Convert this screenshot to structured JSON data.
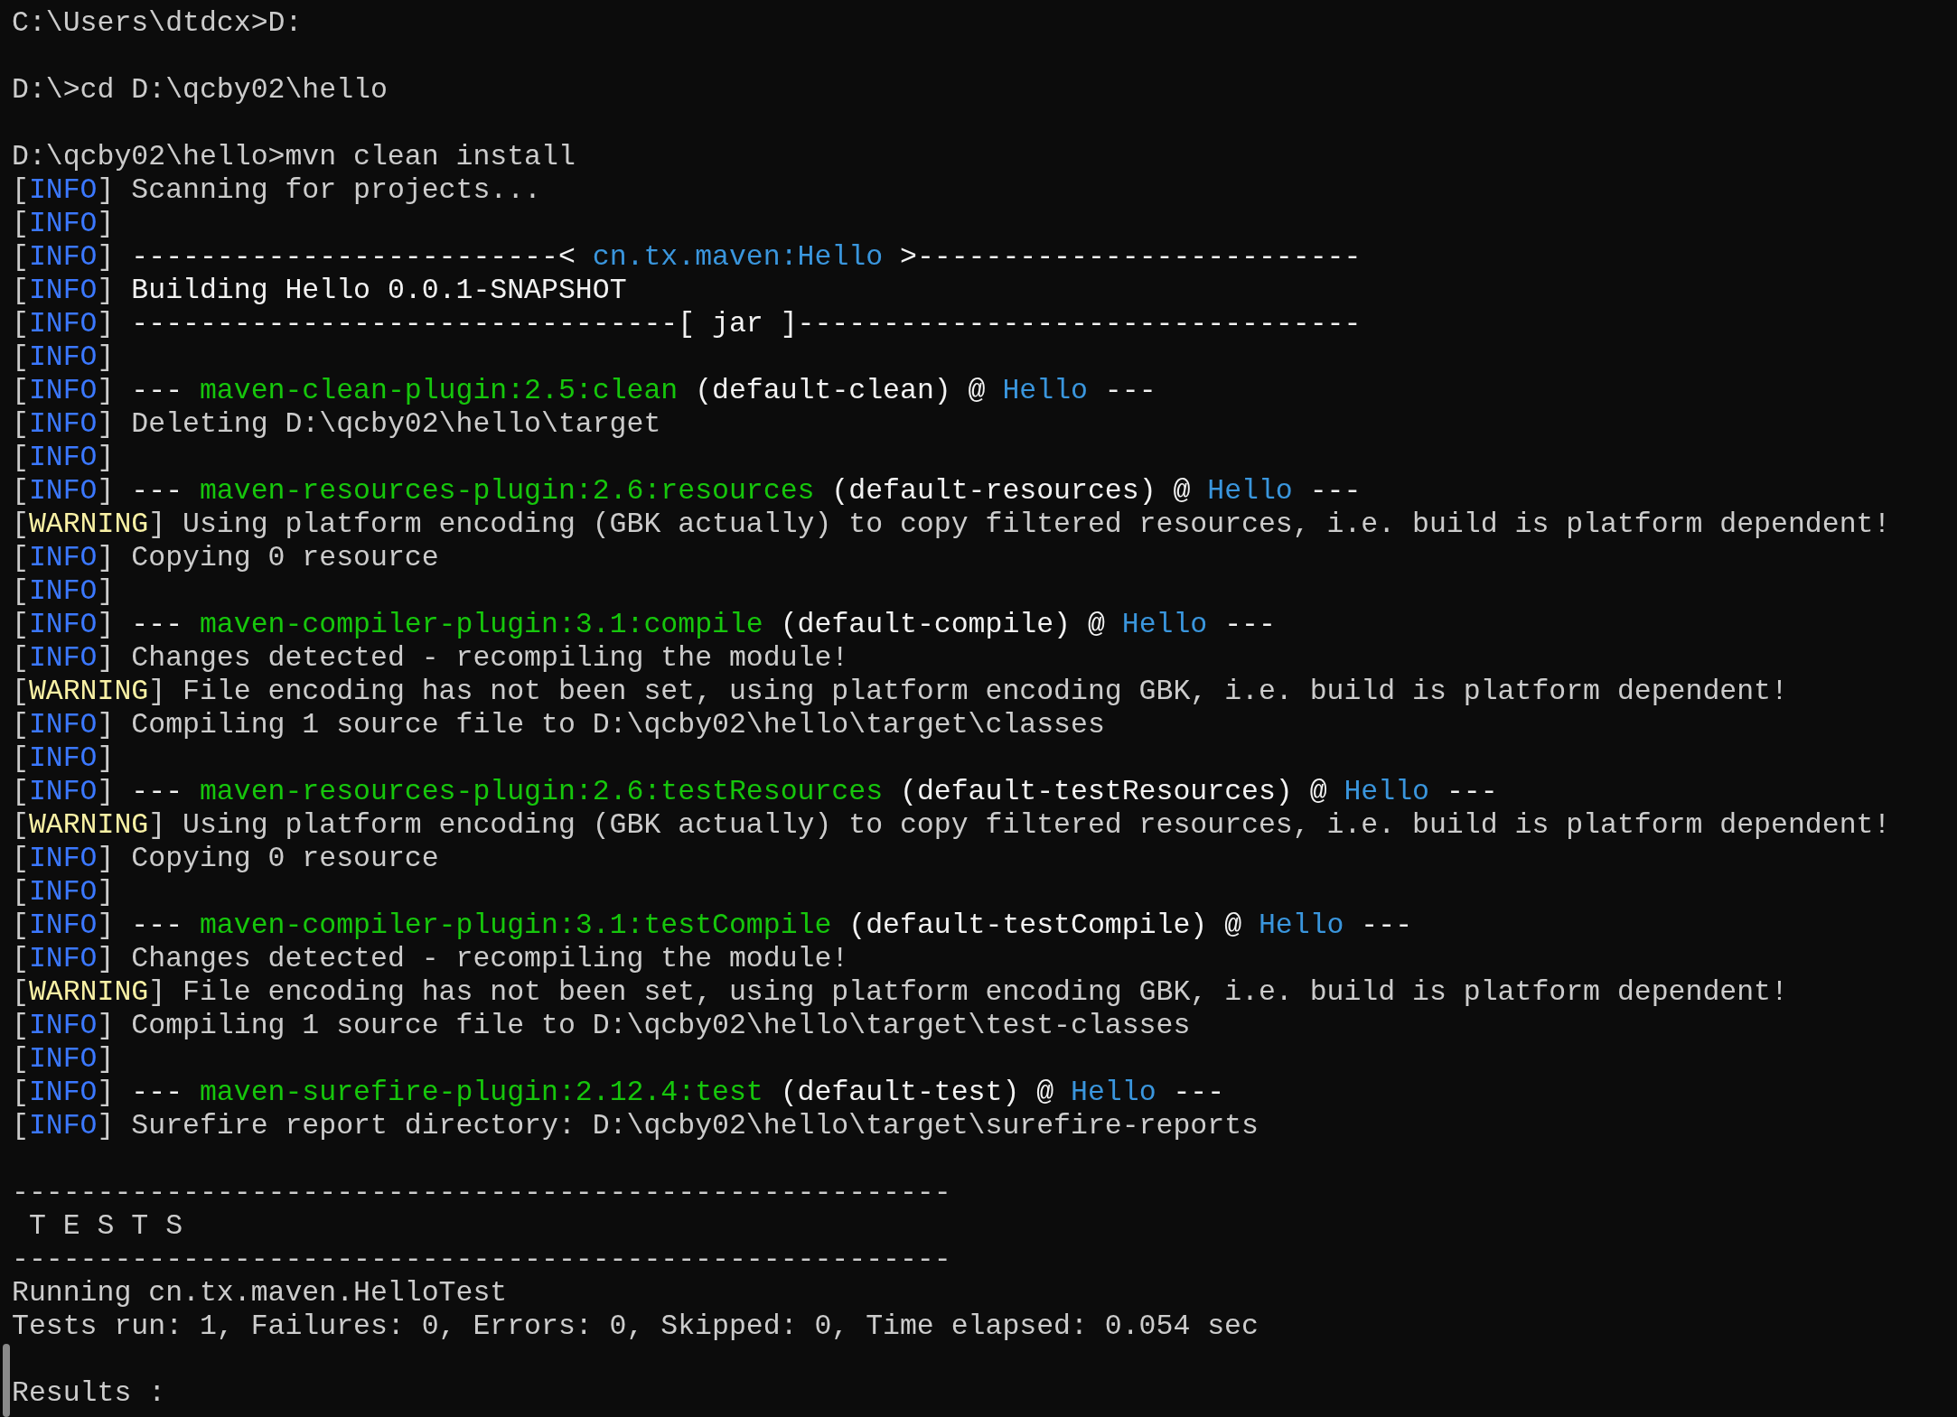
{
  "terminal": {
    "lines": [
      {
        "kind": "text",
        "segments": [
          {
            "kind": "plain",
            "text": "C:\\Users\\dtdcx>D:"
          }
        ]
      },
      {
        "kind": "blank"
      },
      {
        "kind": "text",
        "segments": [
          {
            "kind": "plain",
            "text": "D:\\>cd D:\\qcby02\\hello"
          }
        ]
      },
      {
        "kind": "blank"
      },
      {
        "kind": "text",
        "segments": [
          {
            "kind": "plain",
            "text": "D:\\qcby02\\hello>mvn clean install"
          }
        ]
      },
      {
        "kind": "text",
        "segments": [
          {
            "kind": "plain",
            "text": "["
          },
          {
            "kind": "info",
            "text": "INFO"
          },
          {
            "kind": "plain",
            "text": "] Scanning for projects..."
          }
        ]
      },
      {
        "kind": "text",
        "segments": [
          {
            "kind": "plain",
            "text": "["
          },
          {
            "kind": "info",
            "text": "INFO"
          },
          {
            "kind": "plain",
            "text": "]"
          }
        ]
      },
      {
        "kind": "text",
        "segments": [
          {
            "kind": "plain",
            "text": "["
          },
          {
            "kind": "info",
            "text": "INFO"
          },
          {
            "kind": "plain",
            "text": "]"
          },
          {
            "kind": "bright",
            "text": " -------------------------< "
          },
          {
            "kind": "artifact",
            "text": "cn.tx.maven:Hello"
          },
          {
            "kind": "bright",
            "text": " >--------------------------"
          }
        ]
      },
      {
        "kind": "text",
        "segments": [
          {
            "kind": "plain",
            "text": "["
          },
          {
            "kind": "info",
            "text": "INFO"
          },
          {
            "kind": "plain",
            "text": "]"
          },
          {
            "kind": "bright",
            "text": " Building Hello 0.0.1-SNAPSHOT"
          }
        ]
      },
      {
        "kind": "text",
        "segments": [
          {
            "kind": "plain",
            "text": "["
          },
          {
            "kind": "info",
            "text": "INFO"
          },
          {
            "kind": "plain",
            "text": "]"
          },
          {
            "kind": "bright",
            "text": " --------------------------------[ jar ]---------------------------------"
          }
        ]
      },
      {
        "kind": "text",
        "segments": [
          {
            "kind": "plain",
            "text": "["
          },
          {
            "kind": "info",
            "text": "INFO"
          },
          {
            "kind": "plain",
            "text": "]"
          }
        ]
      },
      {
        "kind": "text",
        "segments": [
          {
            "kind": "plain",
            "text": "["
          },
          {
            "kind": "info",
            "text": "INFO"
          },
          {
            "kind": "plain",
            "text": "]"
          },
          {
            "kind": "bright",
            "text": " --- "
          },
          {
            "kind": "plugin",
            "text": "maven-clean-plugin:2.5:clean"
          },
          {
            "kind": "bright",
            "text": " (default-clean) @ "
          },
          {
            "kind": "artifact",
            "text": "Hello"
          },
          {
            "kind": "bright",
            "text": " ---"
          }
        ]
      },
      {
        "kind": "text",
        "segments": [
          {
            "kind": "plain",
            "text": "["
          },
          {
            "kind": "info",
            "text": "INFO"
          },
          {
            "kind": "plain",
            "text": "] Deleting D:\\qcby02\\hello\\target"
          }
        ]
      },
      {
        "kind": "text",
        "segments": [
          {
            "kind": "plain",
            "text": "["
          },
          {
            "kind": "info",
            "text": "INFO"
          },
          {
            "kind": "plain",
            "text": "]"
          }
        ]
      },
      {
        "kind": "text",
        "segments": [
          {
            "kind": "plain",
            "text": "["
          },
          {
            "kind": "info",
            "text": "INFO"
          },
          {
            "kind": "plain",
            "text": "]"
          },
          {
            "kind": "bright",
            "text": " --- "
          },
          {
            "kind": "plugin",
            "text": "maven-resources-plugin:2.6:resources"
          },
          {
            "kind": "bright",
            "text": " (default-resources) @ "
          },
          {
            "kind": "artifact",
            "text": "Hello"
          },
          {
            "kind": "bright",
            "text": " ---"
          }
        ]
      },
      {
        "kind": "text",
        "segments": [
          {
            "kind": "plain",
            "text": "["
          },
          {
            "kind": "warning",
            "text": "WARNING"
          },
          {
            "kind": "plain",
            "text": "] Using platform encoding (GBK actually) to copy filtered resources, i.e. build is platform dependent!"
          }
        ]
      },
      {
        "kind": "text",
        "segments": [
          {
            "kind": "plain",
            "text": "["
          },
          {
            "kind": "info",
            "text": "INFO"
          },
          {
            "kind": "plain",
            "text": "] Copying 0 resource"
          }
        ]
      },
      {
        "kind": "text",
        "segments": [
          {
            "kind": "plain",
            "text": "["
          },
          {
            "kind": "info",
            "text": "INFO"
          },
          {
            "kind": "plain",
            "text": "]"
          }
        ]
      },
      {
        "kind": "text",
        "segments": [
          {
            "kind": "plain",
            "text": "["
          },
          {
            "kind": "info",
            "text": "INFO"
          },
          {
            "kind": "plain",
            "text": "]"
          },
          {
            "kind": "bright",
            "text": " --- "
          },
          {
            "kind": "plugin",
            "text": "maven-compiler-plugin:3.1:compile"
          },
          {
            "kind": "bright",
            "text": " (default-compile) @ "
          },
          {
            "kind": "artifact",
            "text": "Hello"
          },
          {
            "kind": "bright",
            "text": " ---"
          }
        ]
      },
      {
        "kind": "text",
        "segments": [
          {
            "kind": "plain",
            "text": "["
          },
          {
            "kind": "info",
            "text": "INFO"
          },
          {
            "kind": "plain",
            "text": "] Changes detected - recompiling the module!"
          }
        ]
      },
      {
        "kind": "text",
        "segments": [
          {
            "kind": "plain",
            "text": "["
          },
          {
            "kind": "warning",
            "text": "WARNING"
          },
          {
            "kind": "plain",
            "text": "] File encoding has not been set, using platform encoding GBK, i.e. build is platform dependent!"
          }
        ]
      },
      {
        "kind": "text",
        "segments": [
          {
            "kind": "plain",
            "text": "["
          },
          {
            "kind": "info",
            "text": "INFO"
          },
          {
            "kind": "plain",
            "text": "] Compiling 1 source file to D:\\qcby02\\hello\\target\\classes"
          }
        ]
      },
      {
        "kind": "text",
        "segments": [
          {
            "kind": "plain",
            "text": "["
          },
          {
            "kind": "info",
            "text": "INFO"
          },
          {
            "kind": "plain",
            "text": "]"
          }
        ]
      },
      {
        "kind": "text",
        "segments": [
          {
            "kind": "plain",
            "text": "["
          },
          {
            "kind": "info",
            "text": "INFO"
          },
          {
            "kind": "plain",
            "text": "]"
          },
          {
            "kind": "bright",
            "text": " --- "
          },
          {
            "kind": "plugin",
            "text": "maven-resources-plugin:2.6:testResources"
          },
          {
            "kind": "bright",
            "text": " (default-testResources) @ "
          },
          {
            "kind": "artifact",
            "text": "Hello"
          },
          {
            "kind": "bright",
            "text": " ---"
          }
        ]
      },
      {
        "kind": "text",
        "segments": [
          {
            "kind": "plain",
            "text": "["
          },
          {
            "kind": "warning",
            "text": "WARNING"
          },
          {
            "kind": "plain",
            "text": "] Using platform encoding (GBK actually) to copy filtered resources, i.e. build is platform dependent!"
          }
        ]
      },
      {
        "kind": "text",
        "segments": [
          {
            "kind": "plain",
            "text": "["
          },
          {
            "kind": "info",
            "text": "INFO"
          },
          {
            "kind": "plain",
            "text": "] Copying 0 resource"
          }
        ]
      },
      {
        "kind": "text",
        "segments": [
          {
            "kind": "plain",
            "text": "["
          },
          {
            "kind": "info",
            "text": "INFO"
          },
          {
            "kind": "plain",
            "text": "]"
          }
        ]
      },
      {
        "kind": "text",
        "segments": [
          {
            "kind": "plain",
            "text": "["
          },
          {
            "kind": "info",
            "text": "INFO"
          },
          {
            "kind": "plain",
            "text": "]"
          },
          {
            "kind": "bright",
            "text": " --- "
          },
          {
            "kind": "plugin",
            "text": "maven-compiler-plugin:3.1:testCompile"
          },
          {
            "kind": "bright",
            "text": " (default-testCompile) @ "
          },
          {
            "kind": "artifact",
            "text": "Hello"
          },
          {
            "kind": "bright",
            "text": " ---"
          }
        ]
      },
      {
        "kind": "text",
        "segments": [
          {
            "kind": "plain",
            "text": "["
          },
          {
            "kind": "info",
            "text": "INFO"
          },
          {
            "kind": "plain",
            "text": "] Changes detected - recompiling the module!"
          }
        ]
      },
      {
        "kind": "text",
        "segments": [
          {
            "kind": "plain",
            "text": "["
          },
          {
            "kind": "warning",
            "text": "WARNING"
          },
          {
            "kind": "plain",
            "text": "] File encoding has not been set, using platform encoding GBK, i.e. build is platform dependent!"
          }
        ]
      },
      {
        "kind": "text",
        "segments": [
          {
            "kind": "plain",
            "text": "["
          },
          {
            "kind": "info",
            "text": "INFO"
          },
          {
            "kind": "plain",
            "text": "] Compiling 1 source file to D:\\qcby02\\hello\\target\\test-classes"
          }
        ]
      },
      {
        "kind": "text",
        "segments": [
          {
            "kind": "plain",
            "text": "["
          },
          {
            "kind": "info",
            "text": "INFO"
          },
          {
            "kind": "plain",
            "text": "]"
          }
        ]
      },
      {
        "kind": "text",
        "segments": [
          {
            "kind": "plain",
            "text": "["
          },
          {
            "kind": "info",
            "text": "INFO"
          },
          {
            "kind": "plain",
            "text": "]"
          },
          {
            "kind": "bright",
            "text": " --- "
          },
          {
            "kind": "plugin",
            "text": "maven-surefire-plugin:2.12.4:test"
          },
          {
            "kind": "bright",
            "text": " (default-test) @ "
          },
          {
            "kind": "artifact",
            "text": "Hello"
          },
          {
            "kind": "bright",
            "text": " ---"
          }
        ]
      },
      {
        "kind": "text",
        "segments": [
          {
            "kind": "plain",
            "text": "["
          },
          {
            "kind": "info",
            "text": "INFO"
          },
          {
            "kind": "plain",
            "text": "] Surefire report directory: D:\\qcby02\\hello\\target\\surefire-reports"
          }
        ]
      },
      {
        "kind": "blank"
      },
      {
        "kind": "text",
        "segments": [
          {
            "kind": "plain",
            "text": "-------------------------------------------------------"
          }
        ]
      },
      {
        "kind": "text",
        "segments": [
          {
            "kind": "plain",
            "text": " T E S T S"
          }
        ]
      },
      {
        "kind": "text",
        "segments": [
          {
            "kind": "plain",
            "text": "-------------------------------------------------------"
          }
        ]
      },
      {
        "kind": "text",
        "segments": [
          {
            "kind": "plain",
            "text": "Running cn.tx.maven.HelloTest"
          }
        ]
      },
      {
        "kind": "text",
        "segments": [
          {
            "kind": "plain",
            "text": "Tests run: 1, Failures: 0, Errors: 0, Skipped: 0, Time elapsed: 0.054 sec"
          }
        ]
      },
      {
        "kind": "blank"
      },
      {
        "kind": "text",
        "segments": [
          {
            "kind": "plain",
            "text": "Results :"
          }
        ]
      }
    ]
  }
}
